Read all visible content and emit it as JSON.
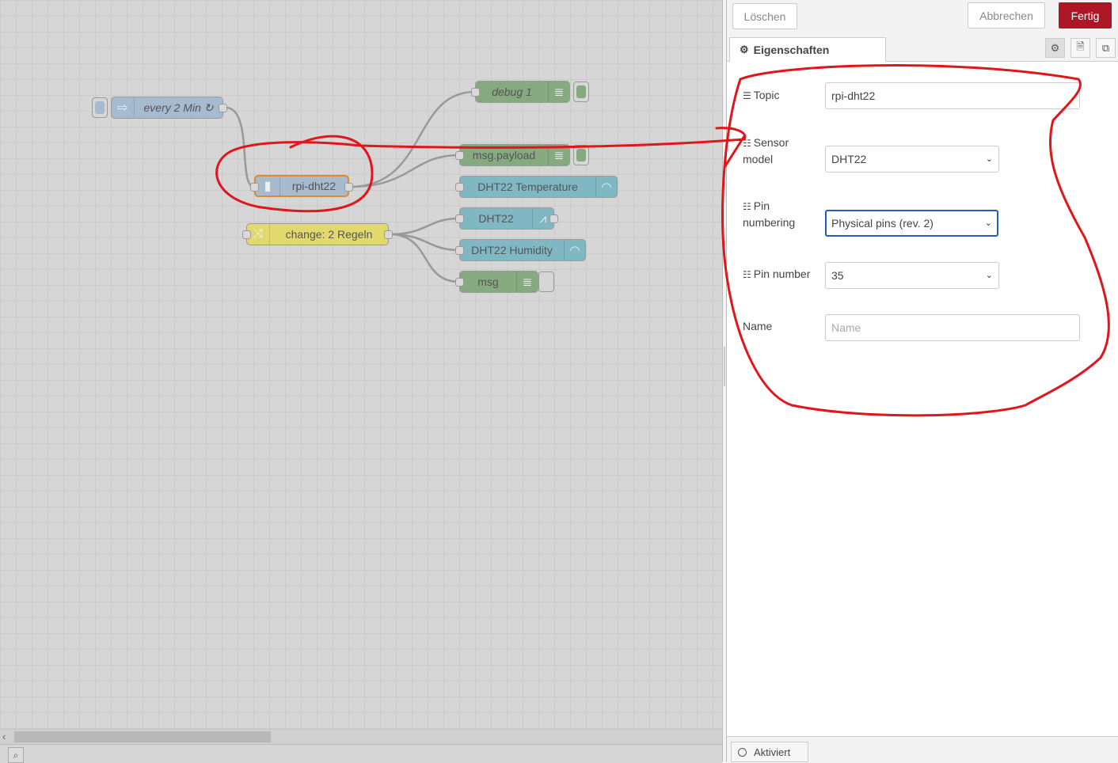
{
  "flow": {
    "nodes": {
      "inject": "every 2 Min ↻",
      "dht": "rpi-dht22",
      "debug1": "debug 1",
      "msg_payload": "msg.payload",
      "temperature": "DHT22 Temperature",
      "chart": "DHT22",
      "change": "change: 2 Regeln",
      "humidity": "DHT22 Humidity",
      "msg": "msg"
    }
  },
  "toolbar": {
    "delete_label": "Löschen",
    "cancel_label": "Abbrechen",
    "done_label": "Fertig"
  },
  "tabs": {
    "properties_label": "Eigenschaften"
  },
  "form": {
    "topic_label": "Topic",
    "topic_value": "rpi-dht22",
    "sensor_label_line1": "Sensor",
    "sensor_label_line2": "model",
    "sensor_value": "DHT22",
    "pinnum_label_line1": "Pin",
    "pinnum_label_line2": "numbering",
    "pinnum_value": "Physical pins (rev. 2)",
    "pin_label": "Pin number",
    "pin_value": "35",
    "name_label": "Name",
    "name_placeholder": "Name"
  },
  "status": {
    "enabled_label": "Aktiviert"
  },
  "colors": {
    "primary_button": "#ad1625",
    "annotation": "#e0161b",
    "focus_border": "#1f5fb8"
  }
}
